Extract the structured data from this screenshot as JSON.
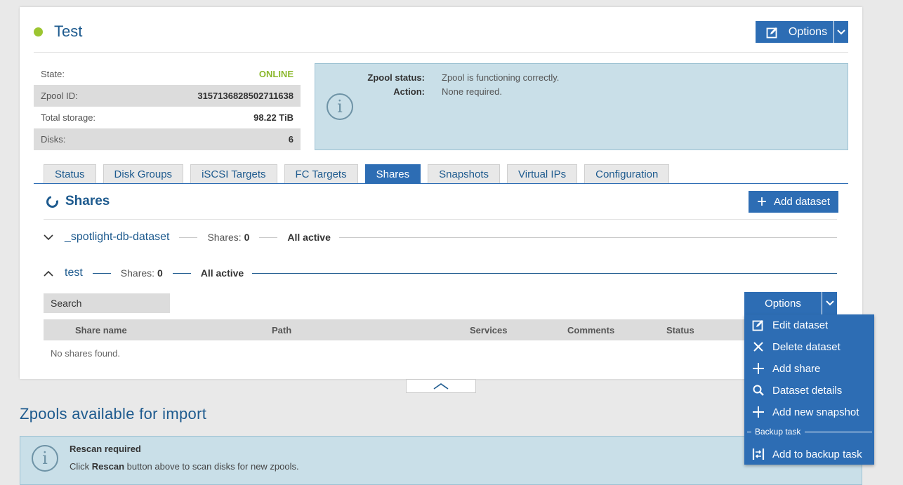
{
  "pool": {
    "name": "Test",
    "status_color": "#9cc531",
    "options_label": "Options",
    "info": [
      {
        "label": "State:",
        "value": "ONLINE"
      },
      {
        "label": "Zpool ID:",
        "value": "3157136828502711638"
      },
      {
        "label": "Total storage:",
        "value": "98.22 TiB"
      },
      {
        "label": "Disks:",
        "value": "6"
      }
    ],
    "status_box": {
      "status_label": "Zpool status:",
      "status_value": "Zpool is functioning correctly.",
      "action_label": "Action:",
      "action_value": "None required."
    }
  },
  "tabs": [
    {
      "label": "Status"
    },
    {
      "label": "Disk Groups"
    },
    {
      "label": "iSCSI Targets"
    },
    {
      "label": "FC Targets"
    },
    {
      "label": "Shares",
      "active": true
    },
    {
      "label": "Snapshots"
    },
    {
      "label": "Virtual IPs"
    },
    {
      "label": "Configuration"
    }
  ],
  "shares": {
    "title": "Shares",
    "add_dataset_label": "Add dataset",
    "datasets": [
      {
        "name": "_spotlight-db-dataset",
        "shares_label": "Shares:",
        "shares_count": "0",
        "state": "All active",
        "expanded": false
      },
      {
        "name": "test",
        "shares_label": "Shares:",
        "shares_count": "0",
        "state": "All active",
        "expanded": true
      }
    ],
    "search_placeholder": "Search",
    "options_label": "Options",
    "columns": [
      "Share name",
      "Path",
      "Services",
      "Comments",
      "Status"
    ],
    "empty_text": "No shares found."
  },
  "dataset_menu": {
    "items": [
      {
        "label": "Edit dataset",
        "icon": "edit-icon"
      },
      {
        "label": "Delete dataset",
        "icon": "close-icon"
      },
      {
        "label": "Add share",
        "icon": "plus-icon"
      },
      {
        "label": "Dataset details",
        "icon": "search-icon"
      },
      {
        "label": "Add new snapshot",
        "icon": "plus-icon"
      }
    ],
    "section_label": "Backup task",
    "backup_item": {
      "label": "Add to backup task",
      "icon": "backup-task-icon"
    }
  },
  "import": {
    "title": "Zpools available for import",
    "box_title": "Rescan required",
    "text_before": "Click ",
    "text_bold": "Rescan",
    "text_after": " button above to scan disks for new zpools."
  },
  "colors": {
    "accent": "#2d6db4",
    "title": "#1d5a8e",
    "online": "#8cb82e",
    "info_bg": "#c9dfe8"
  }
}
